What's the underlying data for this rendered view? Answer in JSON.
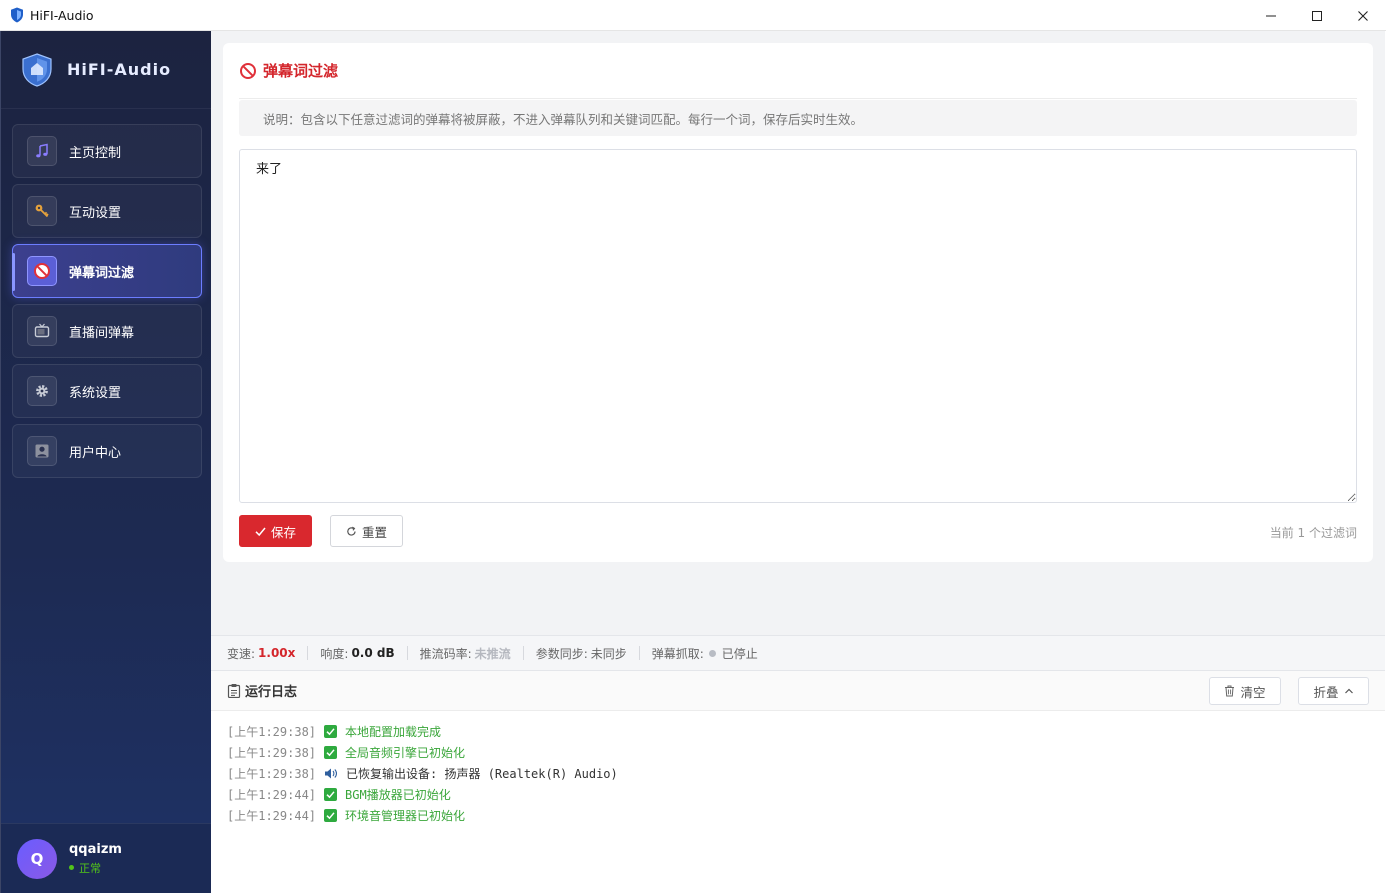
{
  "window": {
    "title": "HiFI-Audio"
  },
  "brand": {
    "name": "HiFI-Audio"
  },
  "nav": {
    "items": [
      {
        "label": "主页控制",
        "icon": "music-note-icon"
      },
      {
        "label": "互动设置",
        "icon": "key-icon"
      },
      {
        "label": "弹幕词过滤",
        "icon": "no-entry-icon",
        "active": true
      },
      {
        "label": "直播间弹幕",
        "icon": "tv-icon"
      },
      {
        "label": "系统设置",
        "icon": "gear-icon"
      },
      {
        "label": "用户中心",
        "icon": "user-icon"
      }
    ]
  },
  "user": {
    "avatar_letter": "Q",
    "name": "qqaizm",
    "status": "正常"
  },
  "filter": {
    "title": "弹幕词过滤",
    "notice": "说明：包含以下任意过滤词的弹幕将被屏蔽，不进入弹幕队列和关键词匹配。每行一个词，保存后实时生效。",
    "content": "来了",
    "save_label": "保存",
    "reset_label": "重置",
    "count_text": "当前 1 个过滤词"
  },
  "status": {
    "speed_label": "变速:",
    "speed_value": "1.00x",
    "volume_label": "响度:",
    "volume_value": "0.0 dB",
    "bitrate_label": "推流码率:",
    "bitrate_value": "未推流",
    "sync_label": "参数同步:",
    "sync_value": "未同步",
    "capture_label": "弹幕抓取:",
    "capture_value": "已停止"
  },
  "log": {
    "title": "运行日志",
    "clear_label": "清空",
    "fold_label": "折叠",
    "entries": [
      {
        "time": "[上午1:29:38]",
        "type": "ok",
        "msg": "本地配置加载完成"
      },
      {
        "time": "[上午1:29:38]",
        "type": "ok",
        "msg": "全局音频引擎已初始化"
      },
      {
        "time": "[上午1:29:38]",
        "type": "info",
        "msg": "已恢复输出设备: 扬声器 (Realtek(R) Audio)"
      },
      {
        "time": "[上午1:29:44]",
        "type": "ok",
        "msg": "BGM播放器已初始化"
      },
      {
        "time": "[上午1:29:44]",
        "type": "ok",
        "msg": "环境音管理器已初始化"
      }
    ]
  },
  "colors": {
    "accent": "#d9282e",
    "sidebar": "#1c2340",
    "success": "#3aa63a",
    "active_nav": "#6c7dff"
  }
}
